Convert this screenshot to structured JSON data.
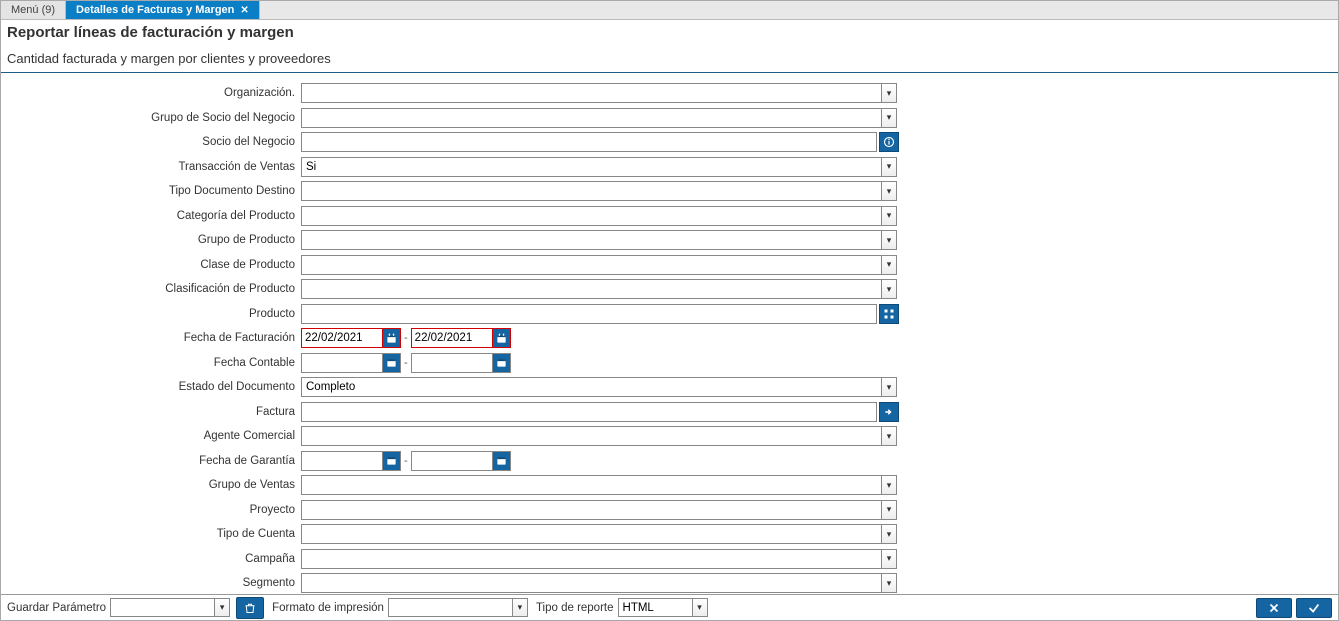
{
  "tabs": {
    "inactive": "Menú (9)",
    "active": "Detalles de Facturas y Margen"
  },
  "header": {
    "title": "Reportar líneas de facturación y margen",
    "subtitle": "Cantidad facturada y margen por clientes y proveedores"
  },
  "labels": {
    "organizacion": "Organización.",
    "grupo_socio": "Grupo de Socio del Negocio",
    "socio": "Socio del Negocio",
    "transaccion_ventas": "Transacción de Ventas",
    "tipo_doc_destino": "Tipo Documento Destino",
    "categoria_producto": "Categoría del Producto",
    "grupo_producto": "Grupo de Producto",
    "clase_producto": "Clase de Producto",
    "clasificacion_producto": "Clasificación de Producto",
    "producto": "Producto",
    "fecha_facturacion": "Fecha de Facturación",
    "fecha_contable": "Fecha Contable",
    "estado_documento": "Estado del Documento",
    "factura": "Factura",
    "agente_comercial": "Agente Comercial",
    "fecha_garantia": "Fecha de Garantía",
    "grupo_ventas": "Grupo de Ventas",
    "proyecto": "Proyecto",
    "tipo_cuenta": "Tipo de Cuenta",
    "campana": "Campaña",
    "segmento": "Segmento"
  },
  "values": {
    "organizacion": "",
    "grupo_socio": "",
    "socio": "",
    "transaccion_ventas": "Si",
    "tipo_doc_destino": "",
    "categoria_producto": "",
    "grupo_producto": "",
    "clase_producto": "",
    "clasificacion_producto": "",
    "producto": "",
    "fecha_facturacion_from": "22/02/2021",
    "fecha_facturacion_to": "22/02/2021",
    "fecha_contable_from": "",
    "fecha_contable_to": "",
    "estado_documento": "Completo",
    "factura": "",
    "agente_comercial": "",
    "fecha_garantia_from": "",
    "fecha_garantia_to": "",
    "grupo_ventas": "",
    "proyecto": "",
    "tipo_cuenta": "",
    "campana": "",
    "segmento": ""
  },
  "footer": {
    "guardar_parametro": "Guardar Parámetro",
    "guardar_parametro_val": "",
    "formato_impresion": "Formato de impresión",
    "formato_impresion_val": "",
    "tipo_reporte": "Tipo de reporte",
    "tipo_reporte_val": "HTML"
  }
}
